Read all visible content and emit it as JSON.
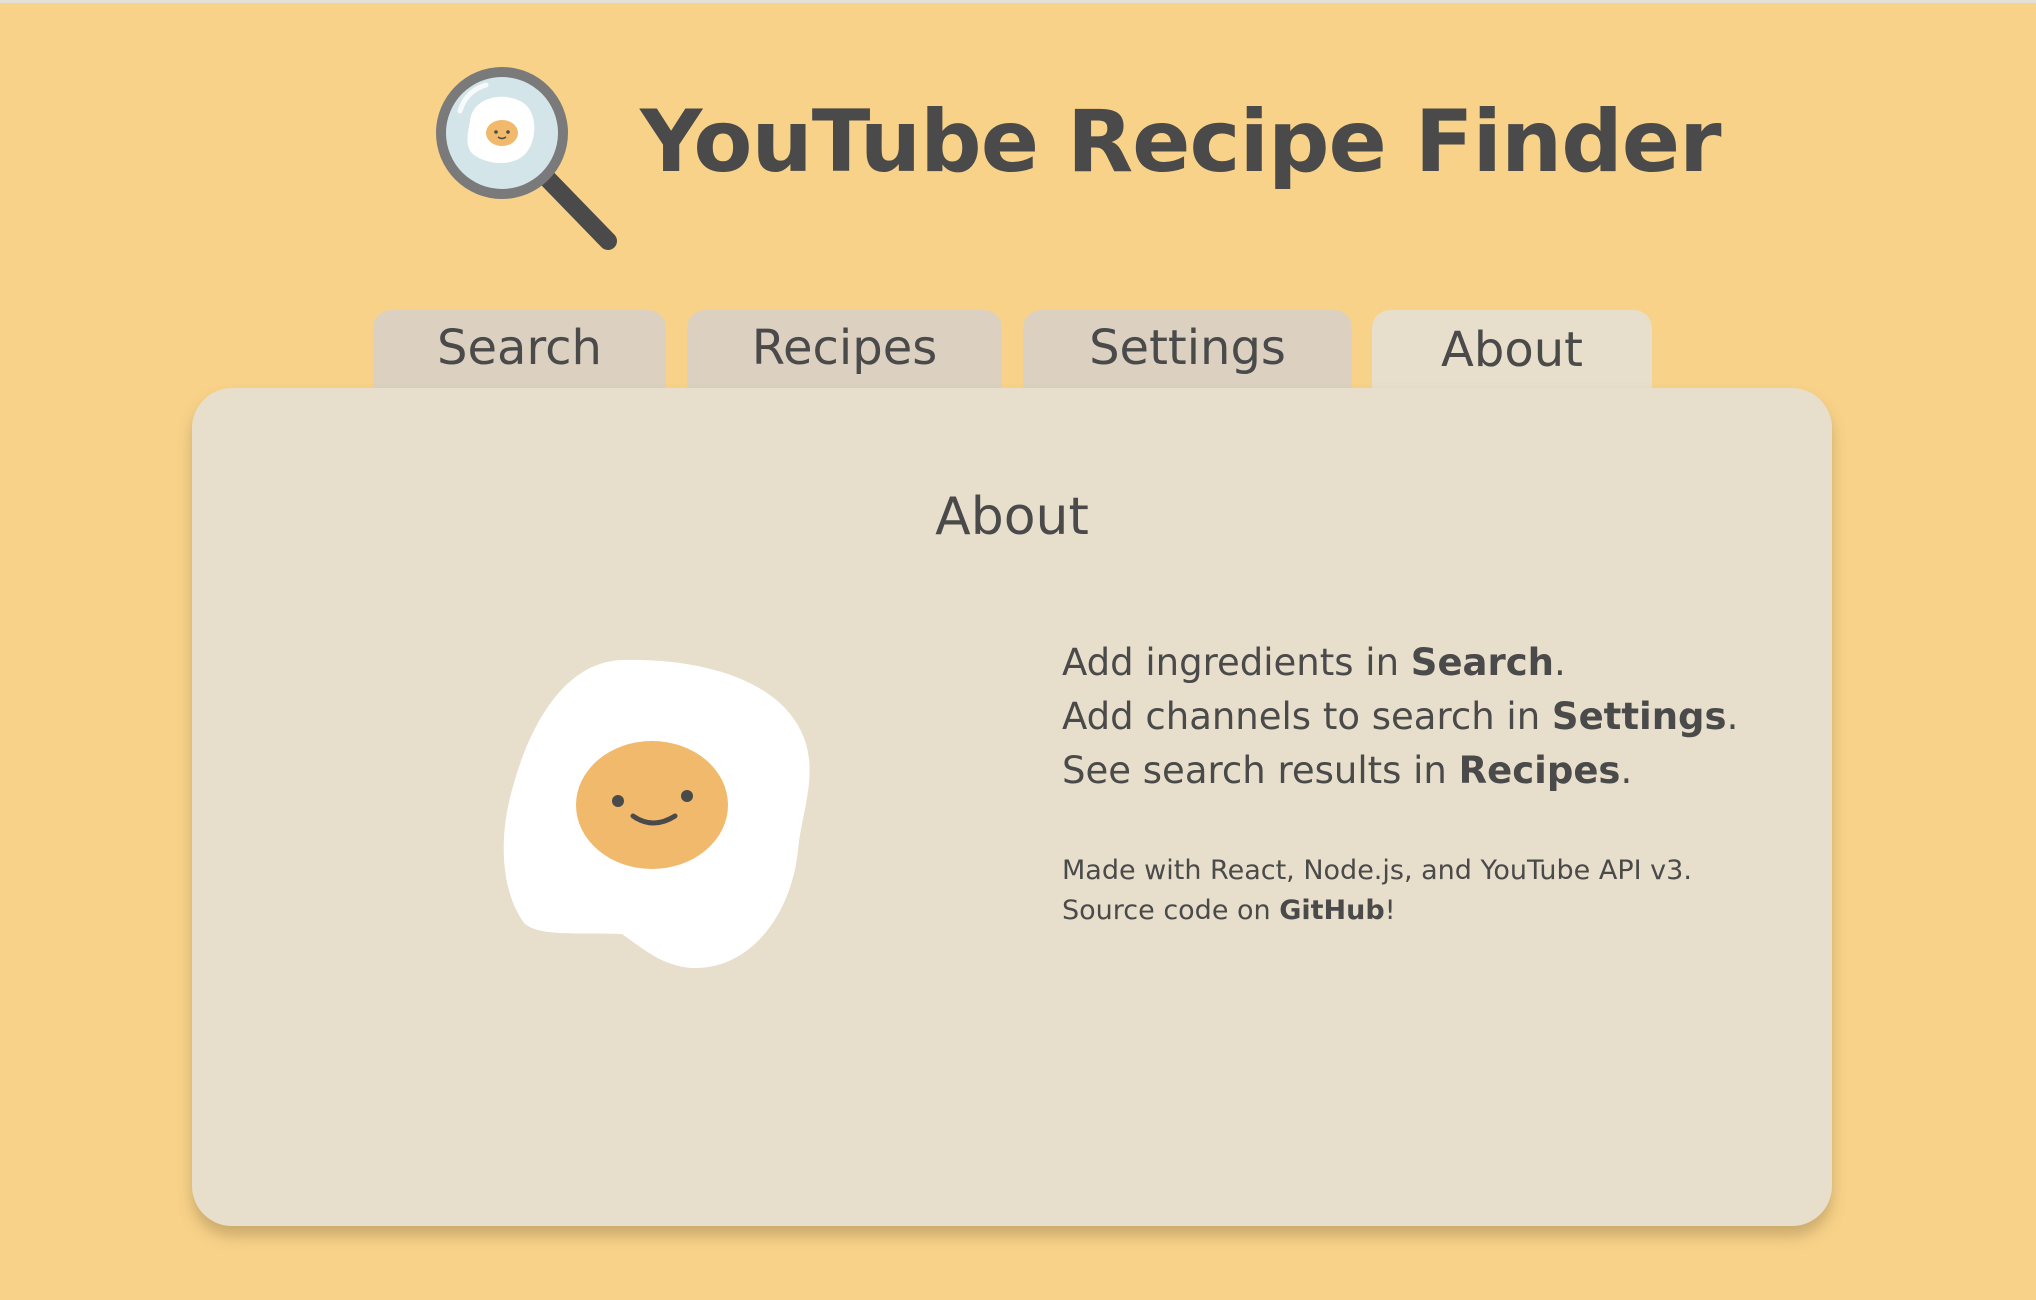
{
  "app": {
    "title": "YouTube Recipe Finder",
    "logo_icon": "magnifying-glass-egg-icon"
  },
  "tabs": [
    {
      "label": "Search",
      "active": false
    },
    {
      "label": "Recipes",
      "active": false
    },
    {
      "label": "Settings",
      "active": false
    },
    {
      "label": "About",
      "active": true
    }
  ],
  "about": {
    "heading": "About",
    "illustration": "fried-egg-icon",
    "lines": [
      {
        "prefix": "Add ingredients in ",
        "link": "Search",
        "suffix": "."
      },
      {
        "prefix": "Add channels to search in ",
        "link": "Settings",
        "suffix": "."
      },
      {
        "prefix": "See search results in ",
        "link": "Recipes",
        "suffix": "."
      }
    ],
    "credits": {
      "made_with": "Made with React, Node.js, and YouTube API v3.",
      "source_prefix": "Source code on ",
      "source_link": "GitHub",
      "source_suffix": "!"
    }
  },
  "colors": {
    "background": "#f8d288",
    "panel": "#e7dfcb",
    "tab_inactive": "#dcd1c1",
    "text": "#4a4a4a",
    "yolk": "#f0b96c"
  }
}
